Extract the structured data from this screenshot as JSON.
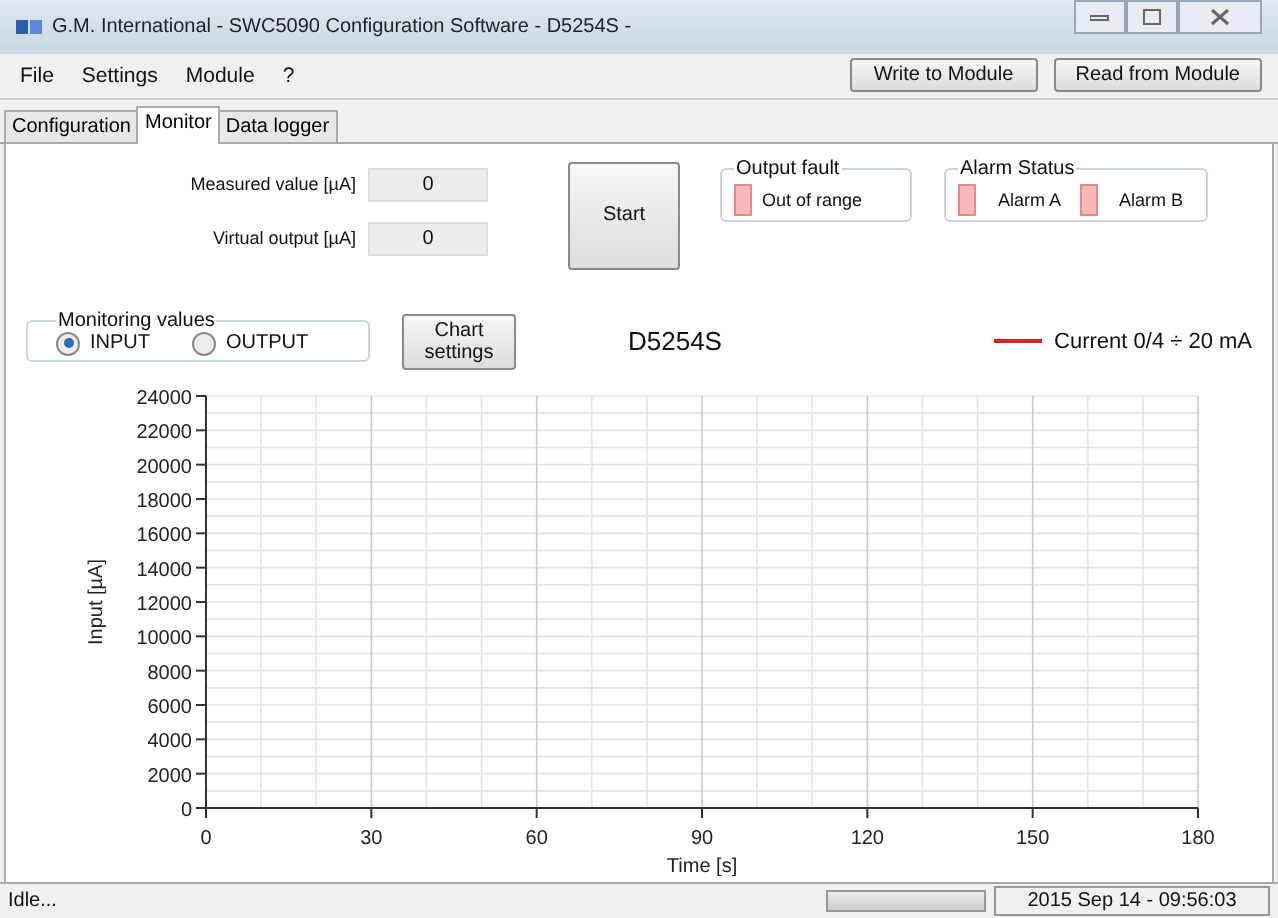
{
  "window": {
    "title": "G.M. International - SWC5090 Configuration Software - D5254S -"
  },
  "menu": [
    "File",
    "Settings",
    "Module",
    "?"
  ],
  "toolbar_buttons": [
    "Write to Module",
    "Read from Module"
  ],
  "tabs": [
    {
      "label": "Configuration",
      "selected": false
    },
    {
      "label": "Monitor",
      "selected": true
    },
    {
      "label": "Data logger",
      "selected": false
    }
  ],
  "readouts": [
    {
      "label": "Measured value [µA]",
      "value": "0"
    },
    {
      "label": "Virtual output [µA]",
      "value": "0"
    }
  ],
  "start_button": "Start",
  "output_fault": {
    "title": "Output fault",
    "indicators": [
      {
        "label": "Out of range",
        "on": false
      }
    ]
  },
  "alarm_status": {
    "title": "Alarm Status",
    "indicators": [
      {
        "label": "Alarm A",
        "on": false
      },
      {
        "label": "Alarm B",
        "on": false
      }
    ]
  },
  "monitoring_values": {
    "title": "Monitoring values",
    "options": [
      {
        "label": "INPUT",
        "selected": true
      },
      {
        "label": "OUTPUT",
        "selected": false
      }
    ]
  },
  "chart_settings_button": "Chart settings",
  "chart": {
    "chart_data": {
      "type": "line",
      "title": "D5254S",
      "xlabel": "Time [s]",
      "ylabel": "Input [µA]",
      "series": [
        {
          "name": "Current 0/4 ÷ 20 mA",
          "color": "#e02020",
          "values": [
            null,
            null,
            null,
            null,
            null,
            null,
            null
          ]
        }
      ],
      "categories": [
        "0",
        "30",
        "60",
        "90",
        "120",
        "150",
        "180"
      ],
      "ylim": [
        0,
        24000
      ],
      "grid": true,
      "yticks": [
        0,
        2000,
        4000,
        6000,
        8000,
        10000,
        12000,
        14000,
        16000,
        18000,
        20000,
        22000,
        24000
      ]
    }
  },
  "status_bar": {
    "status": "Idle...",
    "progress": {
      "level": 0
    },
    "timestamp": "2015 Sep 14 - 09:56:03"
  }
}
